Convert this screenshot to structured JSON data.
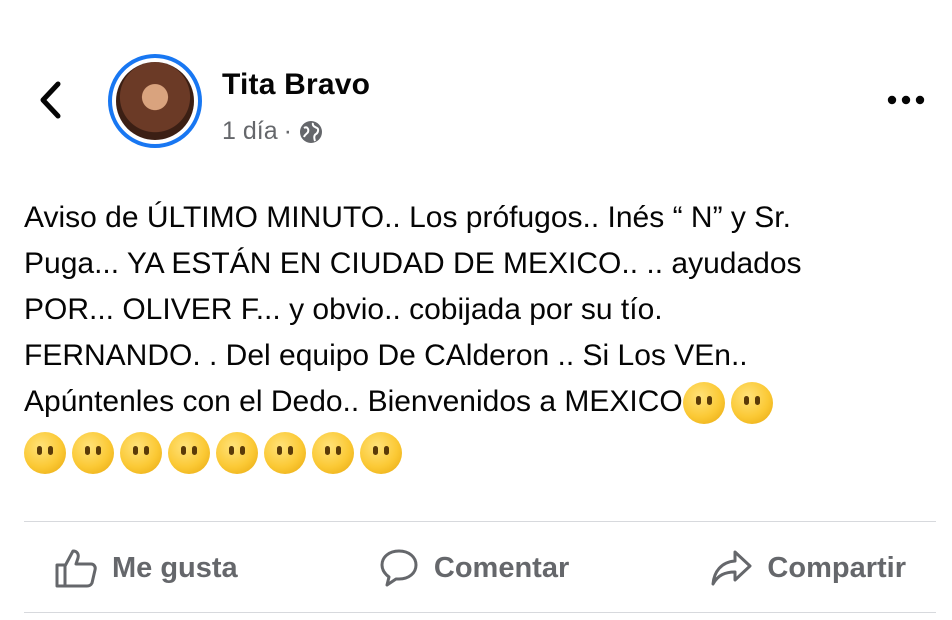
{
  "post": {
    "author": "Tita Bravo",
    "time": "1 día",
    "separator": "·",
    "text_lines": [
      "Aviso de ÚLTIMO MINUTO.. Los prófugos.. Inés “ N” y Sr.",
      "Puga... YA ESTÁN EN CIUDAD DE MEXICO.. .. ayudados",
      "POR... OLIVER F... y obvio.. cobijada por su tío.",
      "FERNANDO. . Del equipo De CAlderon .. Si Los VEn..",
      "Apúntenles con el Dedo.. Bienvenidos a MEXICO"
    ],
    "trailing_emoji_count_line5": 2,
    "emoji_row_count": 8
  },
  "actions": {
    "like": "Me gusta",
    "comment": "Comentar",
    "share": "Compartir"
  },
  "icons": {
    "back": "chevron-left-icon",
    "more": "more-horizontal-icon",
    "audience": "globe-icon",
    "like": "thumbs-up-icon",
    "comment": "speech-bubble-icon",
    "share": "share-arrow-icon",
    "emoji": "face-without-mouth-emoji"
  },
  "colors": {
    "avatar_ring": "#1877f2",
    "secondary_text": "#65676b",
    "divider": "#d7d9dd"
  }
}
